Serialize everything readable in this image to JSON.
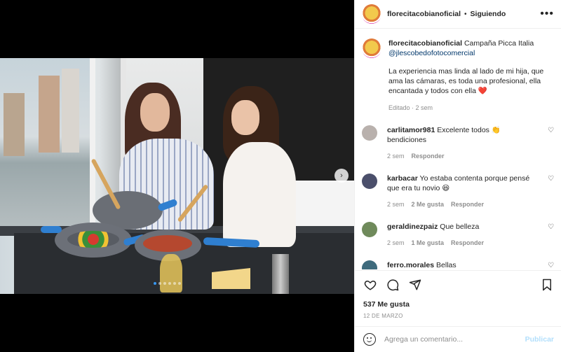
{
  "post": {
    "username": "florecitacobianoficial",
    "separator": "•",
    "follow_status": "Siguiendo",
    "more_label": "•••"
  },
  "caption": {
    "username": "florecitacobianoficial",
    "text_inline": "Campaña Picca Italia",
    "mention": "@jlescobedofotocomercial",
    "body": "La experiencia mas linda al lado de mi hija, que ama las cámaras, es toda una profesional, ella encantada y todos con ella",
    "emoji": "❤️",
    "meta": "Editado · 2 sem"
  },
  "comments": [
    {
      "username": "carlitamor981",
      "text": "Excelente todos 👏 bendiciones",
      "time": "2 sem",
      "likes": "",
      "reply": "Responder",
      "avatar_color": "#b9b1ad"
    },
    {
      "username": "karbacar",
      "text": "Yo estaba contenta porque pensé que era tu novio 😆",
      "time": "2 sem",
      "likes": "2 Me gusta",
      "reply": "Responder",
      "avatar_color": "#4b4f6b"
    },
    {
      "username": "geraldinezpaiz",
      "text": "Que belleza",
      "time": "2 sem",
      "likes": "1 Me gusta",
      "reply": "Responder",
      "avatar_color": "#6f8a5b"
    },
    {
      "username": "ferro.morales",
      "text": "Bellas",
      "time": "",
      "likes": "",
      "reply": "",
      "avatar_color": "#3f6b7d"
    }
  ],
  "actions": {
    "likes": "537 Me gusta",
    "date": "12 DE MARZO"
  },
  "add_comment": {
    "placeholder": "Agrega un comentario...",
    "publish": "Publicar"
  },
  "carousel": {
    "next_label": "›",
    "total_slides": 6,
    "active_slide": 1
  },
  "colors": {
    "accent": "#3897f0",
    "heart": "#ed4956",
    "publish_disabled": "#b2dffc"
  }
}
